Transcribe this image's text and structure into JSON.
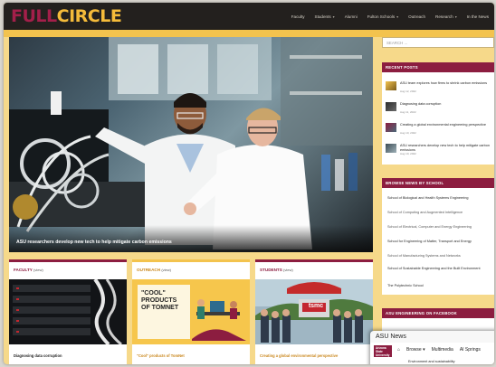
{
  "site": {
    "logo_part1": "FULL",
    "logo_part2": "CIRCLE",
    "colors": {
      "maroon": "#8c1d40",
      "gold": "#f5bb3a",
      "dark": "#23201e"
    }
  },
  "nav": {
    "items": [
      "Faculty",
      "Students",
      "Alumni",
      "Fulton Schools",
      "Outreach",
      "Research",
      "In the News"
    ]
  },
  "hero": {
    "caption": "ASU researchers develop new tech to help mitigate carbon emissions"
  },
  "sidebar": {
    "search_placeholder": "SEARCH ...",
    "recent_posts_heading": "RECENT POSTS",
    "recent_posts": [
      {
        "title": "ASU team explores how firms to shrink carbon emissions",
        "date": "Aug 12, 2022"
      },
      {
        "title": "Diagnosing data corruption",
        "date": "Aug 11, 2022"
      },
      {
        "title": "Creating a global environmental engineering perspective",
        "date": "Aug 10, 2022"
      },
      {
        "title": "ASU researchers develop new tech to help mitigate carbon emissions",
        "date": "Aug 10, 2022"
      }
    ],
    "browse_heading": "BROWSE NEWS BY SCHOOL",
    "schools": [
      "School of Biological and Health Systems Engineering",
      "School of Computing and Augmented Intelligence",
      "School of Electrical, Computer and Energy Engineering",
      "School for Engineering of Matter, Transport and Energy",
      "School of Manufacturing Systems and Networks",
      "School of Sustainable Engineering and the Built Environment",
      "The Polytechnic School"
    ],
    "facebook_heading": "ASU ENGINEERING ON FACEBOOK"
  },
  "cards": [
    {
      "label": "FACULTY",
      "more": "(view)",
      "title": "Diagnosing data corruption",
      "accent": "#8c1d40"
    },
    {
      "label": "OUTREACH",
      "more": "(view)",
      "title": "\"Cool\" products of TomNet",
      "accent": "#f3c34e",
      "poster": {
        "line1": "\"COOL\"",
        "line2": "PRODUCTS",
        "line3": "OF TOMNET"
      }
    },
    {
      "label": "STUDENTS",
      "more": "(view)",
      "title": "Creating a global environmental perspective",
      "accent": "#8c1d40",
      "sign": "tsmc"
    }
  ],
  "popup": {
    "title": "ASU News",
    "logo_text": "Arizona State University",
    "nav": [
      "Browse",
      "Multimedia",
      "AI Springs"
    ],
    "sub": "Environment and sustainability"
  }
}
